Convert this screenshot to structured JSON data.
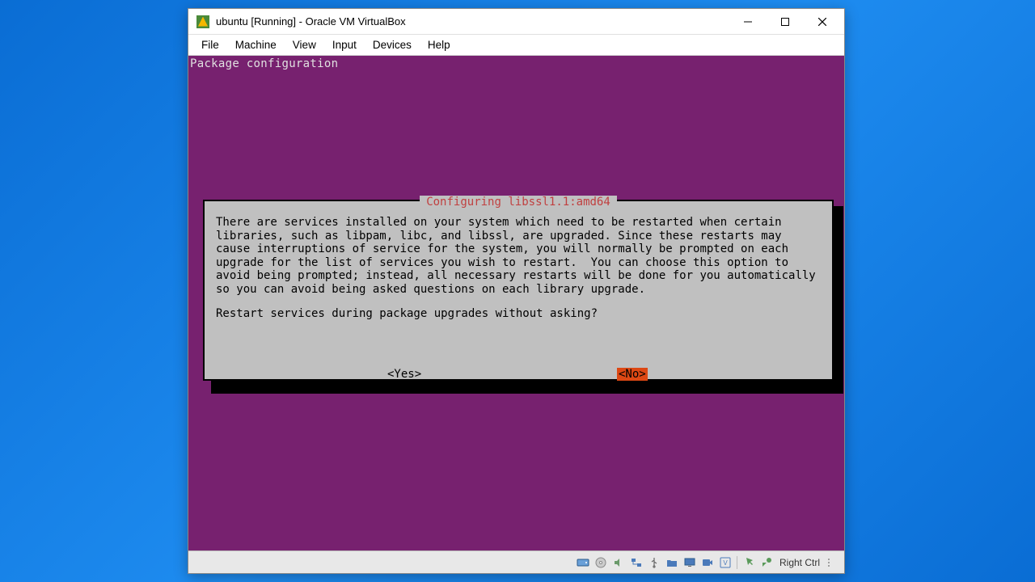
{
  "titlebar": {
    "text": "ubuntu [Running] - Oracle VM VirtualBox"
  },
  "menubar": {
    "items": [
      "File",
      "Machine",
      "View",
      "Input",
      "Devices",
      "Help"
    ]
  },
  "terminal": {
    "header": "Package configuration",
    "dialog": {
      "title": " Configuring libssl1.1:amd64 ",
      "body": "There are services installed on your system which need to be restarted when certain libraries, such as libpam, libc, and libssl, are upgraded. Since these restarts may cause interruptions of service for the system, you will normally be prompted on each upgrade for the list of services you wish to restart.  You can choose this option to avoid being prompted; instead, all necessary restarts will be done for you automatically so you can avoid being asked questions on each library upgrade.",
      "question": "Restart services during package upgrades without asking?",
      "yes_label": "<Yes>",
      "no_label": "<No>"
    }
  },
  "statusbar": {
    "host_key": "Right Ctrl"
  },
  "colors": {
    "ubuntu_purple": "#77216f",
    "ubuntu_orange": "#dd4814",
    "dialog_bg": "#c0c0c0",
    "dialog_title": "#c04040"
  }
}
